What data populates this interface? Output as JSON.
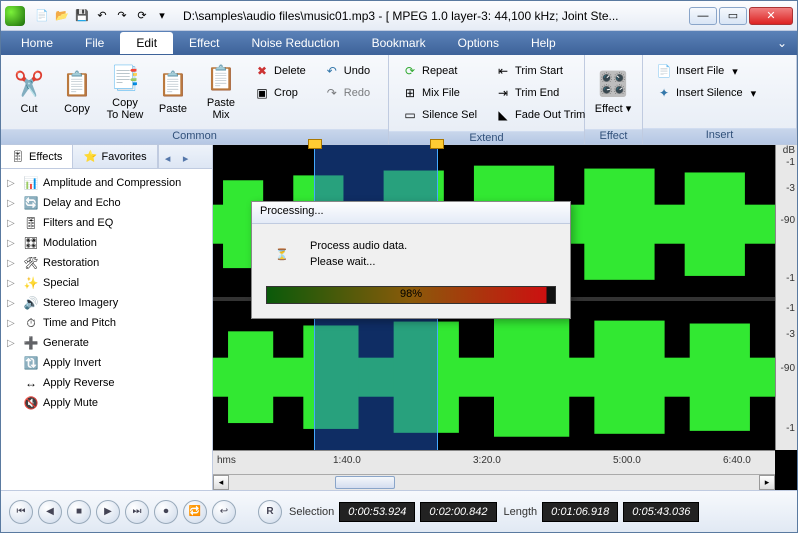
{
  "title": "D:\\samples\\audio files\\music01.mp3 - [ MPEG 1.0 layer-3: 44,100 kHz; Joint Ste...",
  "menu": [
    "Home",
    "File",
    "Edit",
    "Effect",
    "Noise Reduction",
    "Bookmark",
    "Options",
    "Help"
  ],
  "menu_active": "Edit",
  "ribbon": {
    "common": {
      "label": "Common",
      "cut": "Cut",
      "copy": "Copy",
      "copy_new": "Copy\nTo New",
      "paste": "Paste",
      "paste_mix": "Paste\nMix",
      "delete": "Delete",
      "crop": "Crop",
      "undo": "Undo",
      "redo": "Redo"
    },
    "extend": {
      "label": "Extend",
      "repeat": "Repeat",
      "mix": "Mix File",
      "silence_sel": "Silence Sel",
      "trim_start": "Trim Start",
      "trim_end": "Trim End",
      "fade_trim": "Fade Out Trim"
    },
    "effect": {
      "label": "Effect",
      "effect": "Effect"
    },
    "insert": {
      "label": "Insert",
      "ins_file": "Insert File",
      "ins_silence": "Insert Silence"
    }
  },
  "sidebar": {
    "tabs": {
      "effects": "Effects",
      "favorites": "Favorites"
    },
    "items": [
      "Amplitude and Compression",
      "Delay and Echo",
      "Filters and EQ",
      "Modulation",
      "Restoration",
      "Special",
      "Stereo Imagery",
      "Time and Pitch",
      "Generate",
      "Apply Invert",
      "Apply Reverse",
      "Apply Mute"
    ]
  },
  "db_labels": [
    "dB",
    "-1",
    "-3",
    "-90",
    "-1",
    "-1",
    "-3",
    "-90",
    "-1"
  ],
  "timeline": {
    "unit": "hms",
    "marks": [
      "1:40.0",
      "3:20.0",
      "5:00.0",
      "6:40.0"
    ]
  },
  "dialog": {
    "title": "Processing...",
    "line1": "Process audio data.",
    "line2": "Please wait...",
    "progress": "98%"
  },
  "transport": {
    "buttons": [
      "⏮",
      "◀",
      "■",
      "▶",
      "⏭",
      "⏺",
      "🔁",
      "↩"
    ],
    "r": "R",
    "sel_label": "Selection",
    "sel_start": "0:00:53.924",
    "sel_end": "0:02:00.842",
    "len_label": "Length",
    "len_a": "0:01:06.918",
    "len_b": "0:05:43.036"
  }
}
